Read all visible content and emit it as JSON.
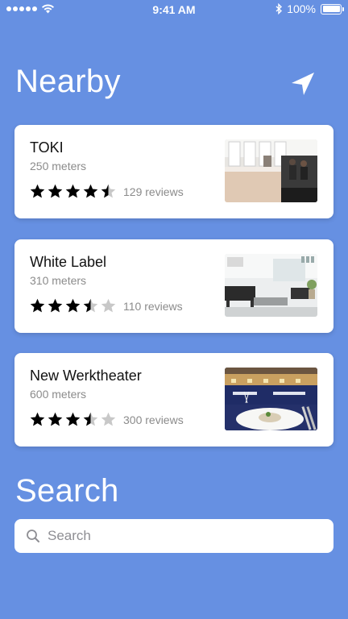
{
  "status_bar": {
    "time": "9:41 AM",
    "battery": "100%",
    "icons": [
      "signal-icon",
      "wifi-icon",
      "bluetooth-icon",
      "battery-icon"
    ]
  },
  "nearby": {
    "title": "Nearby",
    "locate_icon": "location-arrow-icon",
    "places": [
      {
        "name": "TOKI",
        "distance": "250 meters",
        "rating": 4.5,
        "reviews": "129 reviews",
        "photo": "cafe-interior"
      },
      {
        "name": "White Label",
        "distance": "310 meters",
        "rating": 3.5,
        "reviews": "110 reviews",
        "photo": "white-lounge"
      },
      {
        "name": "New Werktheater",
        "distance": "600 meters",
        "rating": 3.5,
        "reviews": "300 reviews",
        "photo": "restaurant-plate"
      }
    ]
  },
  "search": {
    "title": "Search",
    "placeholder": "Search",
    "value": ""
  },
  "colors": {
    "background": "#6690e2",
    "card": "#ffffff",
    "star_filled": "#000000",
    "star_empty": "#c8c8c8",
    "secondary_text": "#8b8b8b"
  }
}
